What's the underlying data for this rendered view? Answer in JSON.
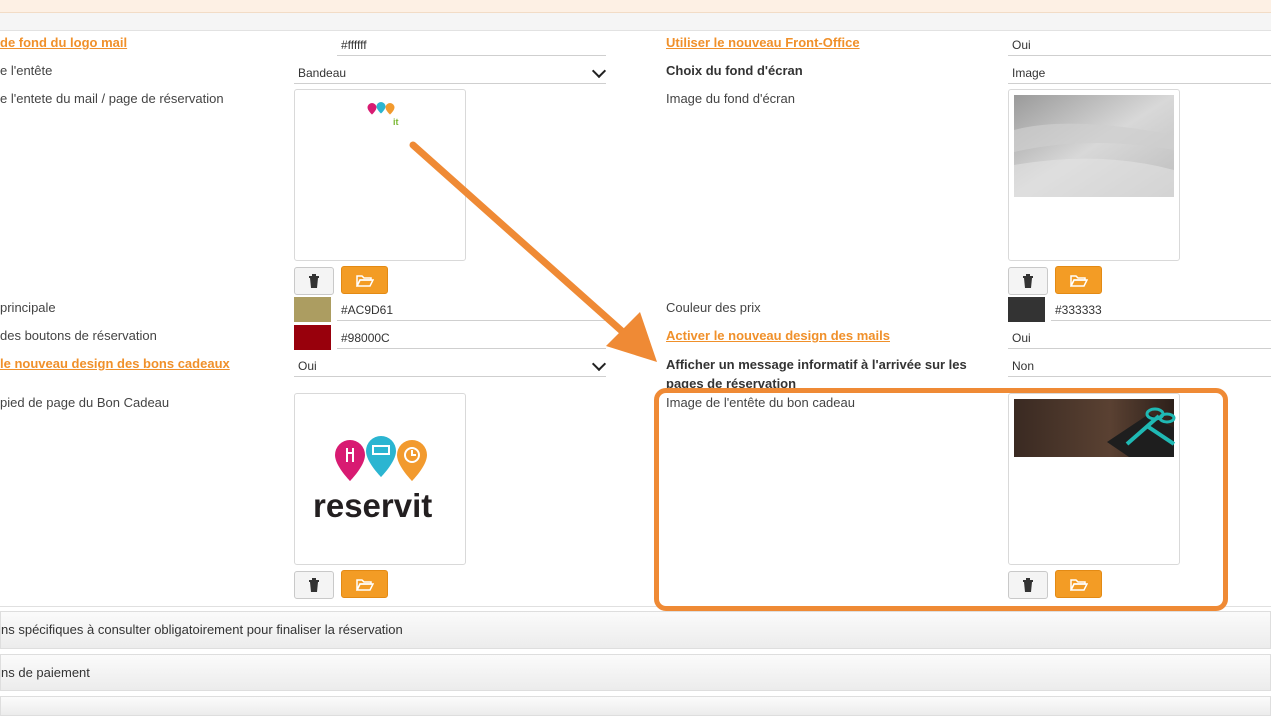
{
  "left": {
    "row1_label": "de fond du logo mail",
    "row1_value": "#ffffff",
    "row2_label": "e l'entête",
    "row2_value": "Bandeau",
    "row3_label": "e l'entete du mail / page de réservation",
    "row3_image_text": "it",
    "row4_label": "principale",
    "row4_value": "#AC9D61",
    "row4_color": "#AC9D61",
    "row5_label": "des boutons de réservation",
    "row5_value": "#98000C",
    "row5_color": "#98000C",
    "row6_label": "le nouveau design des bons cadeaux",
    "row6_value": "Oui",
    "row7_label": "pied de page du Bon Cadeau",
    "row7_logo_text": "reservit"
  },
  "right": {
    "row1_label": "Utiliser le nouveau Front-Office",
    "row1_value": "Oui",
    "row2_label": "Choix du fond d'écran",
    "row2_value": "Image",
    "row3_label": "Image du fond d'écran",
    "row4_label": "Couleur des prix",
    "row4_value": "#333333",
    "row4_color": "#333333",
    "row5_label": "Activer le nouveau design des mails",
    "row5_value": "Oui",
    "row6_label": "Afficher un message informatif à l'arrivée sur les pages de réservation",
    "row6_value": "Non",
    "row7_label": "Image de l'entête du bon cadeau"
  },
  "sections": {
    "conditions": "ns spécifiques à consulter obligatoirement pour finaliser la réservation",
    "payment": "ns de paiement"
  },
  "colors": {
    "accent": "#f39c25",
    "link": "#f0902a",
    "annotation": "#ef8a35"
  },
  "icons": {
    "delete": "trash-icon",
    "browse": "folder-open-icon"
  }
}
